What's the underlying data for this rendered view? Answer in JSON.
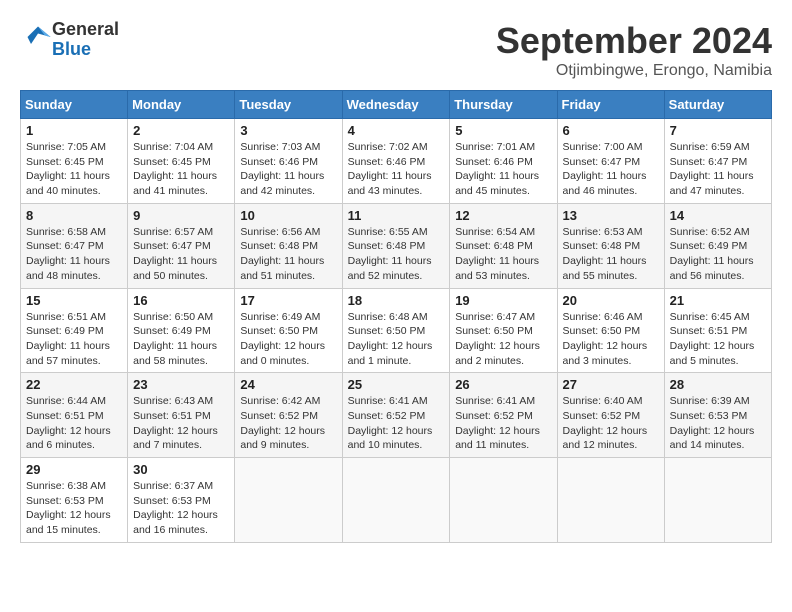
{
  "header": {
    "logo_general": "General",
    "logo_blue": "Blue",
    "month_title": "September 2024",
    "location": "Otjimbingwe, Erongo, Namibia"
  },
  "days_of_week": [
    "Sunday",
    "Monday",
    "Tuesday",
    "Wednesday",
    "Thursday",
    "Friday",
    "Saturday"
  ],
  "weeks": [
    [
      {
        "day": "1",
        "sunrise": "7:05 AM",
        "sunset": "6:45 PM",
        "daylight": "11 hours and 40 minutes."
      },
      {
        "day": "2",
        "sunrise": "7:04 AM",
        "sunset": "6:45 PM",
        "daylight": "11 hours and 41 minutes."
      },
      {
        "day": "3",
        "sunrise": "7:03 AM",
        "sunset": "6:46 PM",
        "daylight": "11 hours and 42 minutes."
      },
      {
        "day": "4",
        "sunrise": "7:02 AM",
        "sunset": "6:46 PM",
        "daylight": "11 hours and 43 minutes."
      },
      {
        "day": "5",
        "sunrise": "7:01 AM",
        "sunset": "6:46 PM",
        "daylight": "11 hours and 45 minutes."
      },
      {
        "day": "6",
        "sunrise": "7:00 AM",
        "sunset": "6:47 PM",
        "daylight": "11 hours and 46 minutes."
      },
      {
        "day": "7",
        "sunrise": "6:59 AM",
        "sunset": "6:47 PM",
        "daylight": "11 hours and 47 minutes."
      }
    ],
    [
      {
        "day": "8",
        "sunrise": "6:58 AM",
        "sunset": "6:47 PM",
        "daylight": "11 hours and 48 minutes."
      },
      {
        "day": "9",
        "sunrise": "6:57 AM",
        "sunset": "6:47 PM",
        "daylight": "11 hours and 50 minutes."
      },
      {
        "day": "10",
        "sunrise": "6:56 AM",
        "sunset": "6:48 PM",
        "daylight": "11 hours and 51 minutes."
      },
      {
        "day": "11",
        "sunrise": "6:55 AM",
        "sunset": "6:48 PM",
        "daylight": "11 hours and 52 minutes."
      },
      {
        "day": "12",
        "sunrise": "6:54 AM",
        "sunset": "6:48 PM",
        "daylight": "11 hours and 53 minutes."
      },
      {
        "day": "13",
        "sunrise": "6:53 AM",
        "sunset": "6:48 PM",
        "daylight": "11 hours and 55 minutes."
      },
      {
        "day": "14",
        "sunrise": "6:52 AM",
        "sunset": "6:49 PM",
        "daylight": "11 hours and 56 minutes."
      }
    ],
    [
      {
        "day": "15",
        "sunrise": "6:51 AM",
        "sunset": "6:49 PM",
        "daylight": "11 hours and 57 minutes."
      },
      {
        "day": "16",
        "sunrise": "6:50 AM",
        "sunset": "6:49 PM",
        "daylight": "11 hours and 58 minutes."
      },
      {
        "day": "17",
        "sunrise": "6:49 AM",
        "sunset": "6:50 PM",
        "daylight": "12 hours and 0 minutes."
      },
      {
        "day": "18",
        "sunrise": "6:48 AM",
        "sunset": "6:50 PM",
        "daylight": "12 hours and 1 minute."
      },
      {
        "day": "19",
        "sunrise": "6:47 AM",
        "sunset": "6:50 PM",
        "daylight": "12 hours and 2 minutes."
      },
      {
        "day": "20",
        "sunrise": "6:46 AM",
        "sunset": "6:50 PM",
        "daylight": "12 hours and 3 minutes."
      },
      {
        "day": "21",
        "sunrise": "6:45 AM",
        "sunset": "6:51 PM",
        "daylight": "12 hours and 5 minutes."
      }
    ],
    [
      {
        "day": "22",
        "sunrise": "6:44 AM",
        "sunset": "6:51 PM",
        "daylight": "12 hours and 6 minutes."
      },
      {
        "day": "23",
        "sunrise": "6:43 AM",
        "sunset": "6:51 PM",
        "daylight": "12 hours and 7 minutes."
      },
      {
        "day": "24",
        "sunrise": "6:42 AM",
        "sunset": "6:52 PM",
        "daylight": "12 hours and 9 minutes."
      },
      {
        "day": "25",
        "sunrise": "6:41 AM",
        "sunset": "6:52 PM",
        "daylight": "12 hours and 10 minutes."
      },
      {
        "day": "26",
        "sunrise": "6:41 AM",
        "sunset": "6:52 PM",
        "daylight": "12 hours and 11 minutes."
      },
      {
        "day": "27",
        "sunrise": "6:40 AM",
        "sunset": "6:52 PM",
        "daylight": "12 hours and 12 minutes."
      },
      {
        "day": "28",
        "sunrise": "6:39 AM",
        "sunset": "6:53 PM",
        "daylight": "12 hours and 14 minutes."
      }
    ],
    [
      {
        "day": "29",
        "sunrise": "6:38 AM",
        "sunset": "6:53 PM",
        "daylight": "12 hours and 15 minutes."
      },
      {
        "day": "30",
        "sunrise": "6:37 AM",
        "sunset": "6:53 PM",
        "daylight": "12 hours and 16 minutes."
      },
      null,
      null,
      null,
      null,
      null
    ]
  ]
}
